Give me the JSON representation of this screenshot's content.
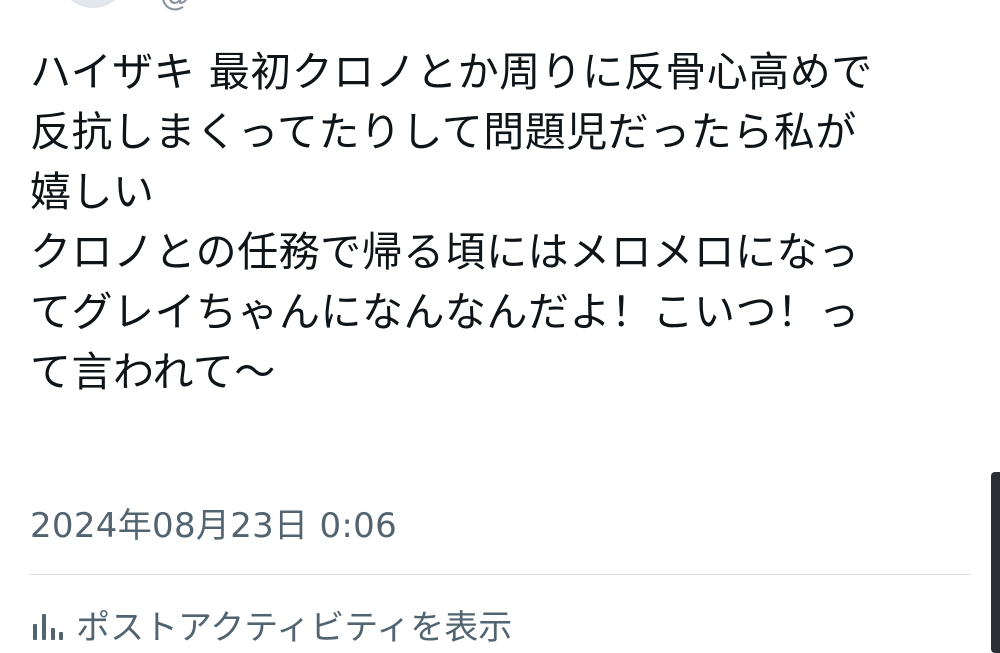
{
  "tweet": {
    "lines": [
      "ハイザキ 最初クロノとか周りに反骨心高めで",
      "反抗しまくってたりして問題児だったら私が",
      "嬉しい",
      "クロノとの任務で帰る頃にはメロメロになっ",
      "てグレイちゃんになんなんだよ！こいつ！っ",
      "て言われて〜"
    ],
    "timestamp": "2024年08月23日 0:06"
  },
  "footer": {
    "activity_label": "ポストアクティビティを表示"
  },
  "colors": {
    "text_primary": "#0f1419",
    "text_secondary": "#536471",
    "divider": "#d6dbe0"
  },
  "icons": {
    "activity": "bar-chart-icon"
  }
}
